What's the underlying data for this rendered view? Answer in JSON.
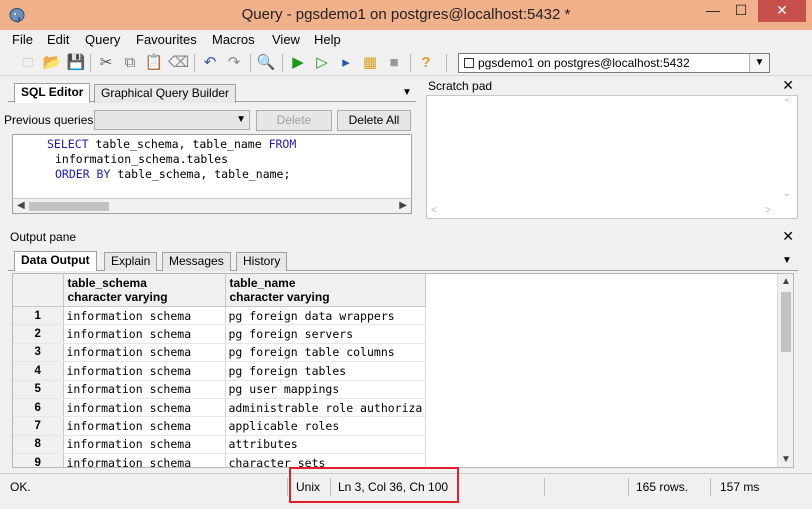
{
  "window": {
    "title": "Query - pgsdemo1 on postgres@localhost:5432 *",
    "minimize": "—",
    "maximize": "☐",
    "close": "✕"
  },
  "menu": [
    "File",
    "Edit",
    "Query",
    "Favourites",
    "Macros",
    "View",
    "Help"
  ],
  "toolbar": {
    "connection": "pgsdemo1 on postgres@localhost:5432"
  },
  "sql_editor": {
    "tabs": [
      "SQL Editor",
      "Graphical Query Builder"
    ],
    "previous_queries_label": "Previous queries",
    "delete_label": "Delete",
    "delete_all_label": "Delete All",
    "code": {
      "l1_kw1": "SELECT",
      "l1_text": " table_schema, table_name ",
      "l1_kw2": "FROM",
      "l2_text": "information_schema.tables",
      "l3_kw": "ORDER BY",
      "l3_text": " table_schema, table_name;"
    }
  },
  "scratch_pad": {
    "title": "Scratch pad"
  },
  "output": {
    "title": "Output pane",
    "tabs": [
      "Data Output",
      "Explain",
      "Messages",
      "History"
    ],
    "columns": [
      {
        "name": "table_schema",
        "type": "character varying"
      },
      {
        "name": "table_name",
        "type": "character varying"
      }
    ],
    "rows": [
      {
        "n": "1",
        "schema": "information schema",
        "name": " pg foreign data wrappers"
      },
      {
        "n": "2",
        "schema": "information schema",
        "name": " pg foreign servers"
      },
      {
        "n": "3",
        "schema": "information schema",
        "name": " pg foreign table columns"
      },
      {
        "n": "4",
        "schema": "information schema",
        "name": " pg foreign tables"
      },
      {
        "n": "5",
        "schema": "information schema",
        "name": " pg user mappings"
      },
      {
        "n": "6",
        "schema": "information schema",
        "name": "administrable role authoriza"
      },
      {
        "n": "7",
        "schema": "information schema",
        "name": "applicable roles"
      },
      {
        "n": "8",
        "schema": "information schema",
        "name": "attributes"
      },
      {
        "n": "9",
        "schema": "information schema",
        "name": "character sets"
      }
    ]
  },
  "status": {
    "state": "OK.",
    "line_ending": "Unix",
    "position": "Ln 3, Col 36, Ch 100",
    "rows": "165 rows.",
    "time": "157 ms"
  }
}
